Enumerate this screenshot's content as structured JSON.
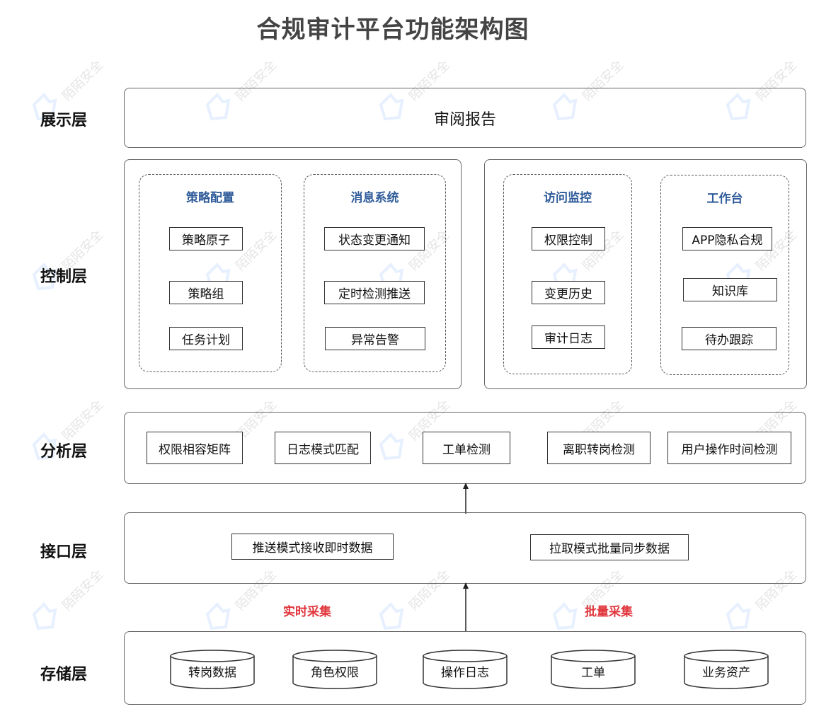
{
  "title": "合规审计平台功能架构图",
  "watermark": "陌陌安全",
  "layers": {
    "presentation": {
      "label": "展示层",
      "content": "审阅报告"
    },
    "control": {
      "label": "控制层",
      "groups": [
        {
          "title": "策略配置",
          "items": [
            "策略原子",
            "策略组",
            "任务计划"
          ]
        },
        {
          "title": "消息系统",
          "items": [
            "状态变更通知",
            "定时检测推送",
            "异常告警"
          ]
        },
        {
          "title": "访问监控",
          "items": [
            "权限控制",
            "变更历史",
            "审计日志"
          ]
        },
        {
          "title": "工作台",
          "items": [
            "APP隐私合规",
            "知识库",
            "待办跟踪"
          ]
        }
      ]
    },
    "analysis": {
      "label": "分析层",
      "items": [
        "权限相容矩阵",
        "日志模式匹配",
        "工单检测",
        "离职转岗检测",
        "用户操作时间检测"
      ]
    },
    "interface": {
      "label": "接口层",
      "items": [
        "推送模式接收即时数据",
        "拉取模式批量同步数据"
      ]
    },
    "collection": {
      "realtime": "实时采集",
      "batch": "批量采集"
    },
    "storage": {
      "label": "存储层",
      "items": [
        "转岗数据",
        "角色权限",
        "操作日志",
        "工单",
        "业务资产"
      ]
    }
  },
  "colors": {
    "group_title": "#2f5b9a",
    "collection_label": "#e0363c",
    "border": "#666666"
  }
}
